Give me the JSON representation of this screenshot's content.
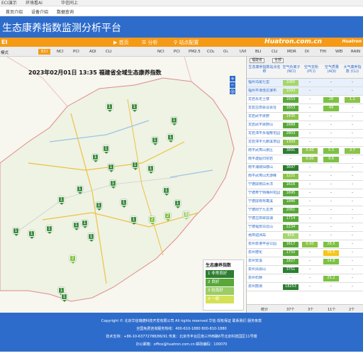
{
  "browser": {
    "items": [
      "ECI演示",
      "环境看AI",
      "华信同上"
    ]
  },
  "subnav": {
    "items": [
      "首页介绍",
      "设备介绍",
      "数据查询"
    ]
  },
  "header": {
    "title": "生态康养指数监测分析平台"
  },
  "tabbar": {
    "left_label": "EI",
    "tabs": [
      "▶ 首页",
      "☰ 分析",
      "⚲ 站点配置"
    ],
    "brand": "Huatron.com.cn",
    "brand2": "Huatron"
  },
  "indexbar": {
    "left_label": "模式",
    "main_indices": [
      "ECI",
      "NCI",
      "PCI",
      "AQI",
      "CLI"
    ],
    "right_indices": [
      "NCI",
      "PCI",
      "PM2.5",
      "CO₂",
      "O₃",
      "UVI",
      "BLI",
      "CLI",
      "MDR",
      "DI",
      "THI",
      "WEI",
      "RAIN"
    ]
  },
  "map": {
    "title": "2023年02月01日 13:35 福建省全域生态康养指数",
    "zoom_in": "+",
    "zoom_out": "−",
    "locate": "◎"
  },
  "legend": {
    "title": "生态康养指数",
    "items": [
      {
        "label": "1 非常良好",
        "color": "#2e7d32"
      },
      {
        "label": "2 良好",
        "color": "#5aa83a"
      },
      {
        "label": "3 较良好",
        "color": "#9ccc65"
      },
      {
        "label": "4 一般",
        "color": "#d4e157"
      }
    ]
  },
  "panel": {
    "dropdown1": "福建省",
    "dropdown2": "全部",
    "columns": [
      "生态康养指数站点名称",
      "空气负离子 (NCI)",
      "空气花粉 (PCI)",
      "空气质量 (AQI)",
      "大气康养指数 (CLI)"
    ],
    "rows": [
      {
        "name": "福州马尾七里",
        "nci": "1065",
        "pci": "-",
        "aqi": "-",
        "cli": "-",
        "hl": true
      },
      {
        "name": "福州平潭佳达瀑布",
        "nci": "1093",
        "pci": "-",
        "aqi": "-",
        "cli": "-",
        "hl": true
      },
      {
        "name": "龙岩永定土楼",
        "nci": "1653",
        "pci": "-",
        "aqi": "28",
        "cli": "1.1",
        "hl": false
      },
      {
        "name": "龙岩古田会议会址",
        "nci": "1653",
        "pci": "-",
        "aqi": "49",
        "cli": "-",
        "hl": false
      },
      {
        "name": "龙岩武平梁野",
        "nci": "1435",
        "pci": "-",
        "aqi": "-",
        "cli": "-",
        "hl": false
      },
      {
        "name": "龙岩武平梁野山",
        "nci": "1689",
        "pci": "-",
        "aqi": "-",
        "cli": "-",
        "hl": false
      },
      {
        "name": "龙岩漳平永福樱花园",
        "nci": "2803",
        "pci": "-",
        "aqi": "-",
        "cli": "-",
        "hl": false
      },
      {
        "name": "龙岩漳平九鹏溪茶园",
        "nci": "1309",
        "pci": "-",
        "aqi": "-",
        "cli": "-",
        "hl": false
      },
      {
        "name": "南平武夷山景区",
        "nci": "3891",
        "pci": "0.00",
        "aqi": "5.3",
        "cli": "3.7",
        "hl": false
      },
      {
        "name": "南平建瓯归宗岩",
        "nci": "-",
        "pci": "0.00",
        "aqi": "9.6",
        "cli": "-",
        "hl": false
      },
      {
        "name": "南平浦城仙楼山",
        "nci": "3697",
        "pci": "-",
        "aqi": "-",
        "cli": "-",
        "hl": false
      },
      {
        "name": "南平武夷山天游峰",
        "nci": "1221",
        "pci": "-",
        "aqi": "-",
        "cli": "-",
        "hl": false
      },
      {
        "name": "宁德屏南白水洋",
        "nci": "1616",
        "pci": "-",
        "aqi": "-",
        "cli": "-",
        "hl": false
      },
      {
        "name": "宁德寿宁杨梅州花园",
        "nci": "1695",
        "pci": "-",
        "aqi": "-",
        "cli": "-",
        "hl": false
      },
      {
        "name": "宁德屏南鸳鸯溪",
        "nci": "1886",
        "pci": "-",
        "aqi": "-",
        "cli": "-",
        "hl": false
      },
      {
        "name": "宁德周宁九龙漈",
        "nci": "2061",
        "pci": "-",
        "aqi": "-",
        "cli": "-",
        "hl": false
      },
      {
        "name": "宁德古田翠屏湖",
        "nci": "1714",
        "pci": "-",
        "aqi": "-",
        "cli": "-",
        "hl": false
      },
      {
        "name": "宁德福安白云山",
        "nci": "2234",
        "pci": "-",
        "aqi": "-",
        "cli": "-",
        "hl": false
      },
      {
        "name": "莆田湄洲岛",
        "nci": "959",
        "pci": "-",
        "aqi": "-",
        "cli": "-",
        "hl": false
      },
      {
        "name": "泉州泉港丰谷公园",
        "nci": "1617",
        "pci": "0.00",
        "aqi": "28.5",
        "cli": "-",
        "hl": false
      },
      {
        "name": "泉州德化",
        "nci": "1750",
        "pci": "-",
        "aqi": "56.5",
        "cli": "-",
        "hl": false
      },
      {
        "name": "泉州安溪",
        "nci": "1827",
        "pci": "-",
        "aqi": "14.8",
        "cli": "-",
        "hl": false
      },
      {
        "name": "泉州清源山",
        "nci": "3751",
        "pci": "-",
        "aqi": "-",
        "cli": "-",
        "hl": false
      },
      {
        "name": "泉州石狮",
        "nci": "-",
        "pci": "-",
        "aqi": "25.2",
        "cli": "-",
        "hl": false
      },
      {
        "name": "泉州鼓浪",
        "nci": "18253",
        "pci": "-",
        "aqi": "-",
        "cli": "-",
        "hl": false
      }
    ],
    "footer": [
      "统计",
      "37个",
      "3个",
      "11个",
      "2个"
    ]
  },
  "footer": {
    "line1": "Copyright © 北京华信瑞德科技开发有限公司   All rights reserved   华信·现有保证   联系我们   服务条款",
    "line2": "全国免费咨询服务热线：400-610-1880 800-810-1880",
    "line3": "技术支持：+86-10-63772788/86/91    传真：北京市丰台区南三环西路6号北京科技园区11号楼",
    "line4": "办公邮箱：office@huatron.com.cn    邮政编码：100070"
  },
  "markers": [
    {
      "label": "1",
      "level": 1
    },
    {
      "label": "1",
      "level": 1
    },
    {
      "label": "1",
      "level": 1
    },
    {
      "label": "1",
      "level": 1
    },
    {
      "label": "1",
      "level": 1
    },
    {
      "label": "1",
      "level": 1
    },
    {
      "label": "1",
      "level": 1
    },
    {
      "label": "1",
      "level": 1
    },
    {
      "label": "1",
      "level": 1
    },
    {
      "label": "1",
      "level": 1
    },
    {
      "label": "1",
      "level": 1
    },
    {
      "label": "1",
      "level": 1
    },
    {
      "label": "1",
      "level": 1
    },
    {
      "label": "1",
      "level": 1
    },
    {
      "label": "1",
      "level": 1
    },
    {
      "label": "1",
      "level": 1
    },
    {
      "label": "1",
      "level": 1
    },
    {
      "label": "1",
      "level": 1
    },
    {
      "label": "1",
      "level": 1
    },
    {
      "label": "1",
      "level": 1
    },
    {
      "label": "1",
      "level": 1
    },
    {
      "label": "2",
      "level": 2
    },
    {
      "label": "1",
      "level": 1
    },
    {
      "label": "1",
      "level": 1
    },
    {
      "label": "2",
      "level": 2
    },
    {
      "label": "2",
      "level": 2
    },
    {
      "label": "3",
      "level": 3
    },
    {
      "label": "1",
      "level": 1
    },
    {
      "label": "1",
      "level": 1
    },
    {
      "label": "1",
      "level": 1
    }
  ]
}
